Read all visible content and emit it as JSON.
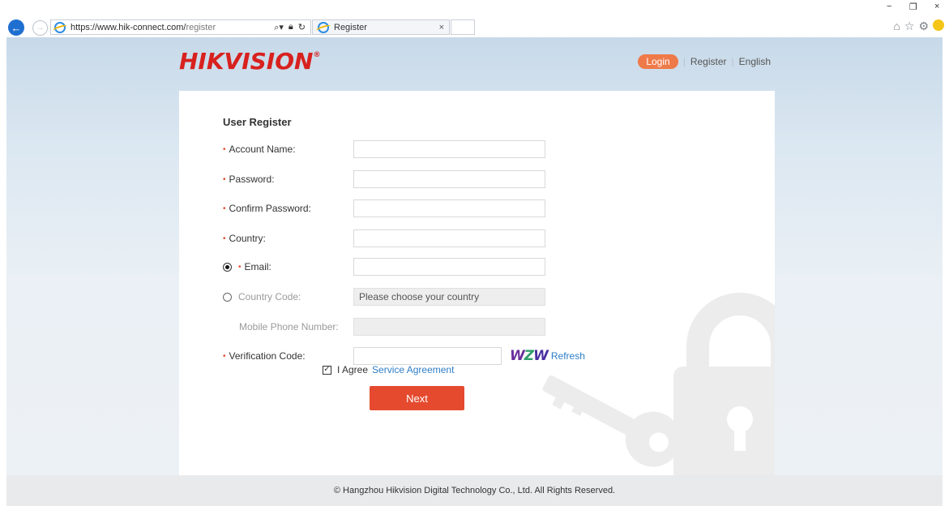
{
  "browser": {
    "url_host": "https://www.hik-connect.com/",
    "url_path": "register",
    "tab_title": "Register",
    "tab_close": "×",
    "minimize": "−",
    "restore": "❐",
    "close": "×"
  },
  "header": {
    "logo": "HIKVISION",
    "logo_mark": "®",
    "login": "Login",
    "register": "Register",
    "language": "English"
  },
  "form": {
    "title": "User Register",
    "required_mark": "•",
    "account_name": {
      "label": "Account Name:",
      "value": ""
    },
    "password": {
      "label": "Password:",
      "value": ""
    },
    "confirm_password": {
      "label": "Confirm Password:",
      "value": ""
    },
    "country": {
      "label": "Country:",
      "value": ""
    },
    "email": {
      "label": "Email:",
      "value": "",
      "selected": true
    },
    "country_code": {
      "label": "Country Code:",
      "value": "Please choose your country",
      "selected": false
    },
    "mobile": {
      "label": "Mobile Phone Number:",
      "value": ""
    },
    "verification": {
      "label": "Verification Code:",
      "value": "",
      "captcha": [
        "W",
        "Z",
        "W"
      ],
      "refresh": "Refresh"
    },
    "agree": {
      "checked": true,
      "text": "I Agree",
      "link": "Service Agreement"
    },
    "next": "Next"
  },
  "footer": {
    "text": "© Hangzhou Hikvision Digital Technology Co., Ltd. All Rights Reserved."
  },
  "colors": {
    "brand_red": "#d8211e",
    "login_orange": "#ef7a49",
    "next_red": "#e54a2f",
    "link_blue": "#2e7ec7"
  },
  "icons": [
    "back-arrow-icon",
    "forward-arrow-icon",
    "ie-icon",
    "search-icon",
    "lock-icon",
    "refresh-icon",
    "home-icon",
    "star-icon",
    "gear-icon",
    "smiley-icon",
    "padlock-key-illustration"
  ]
}
